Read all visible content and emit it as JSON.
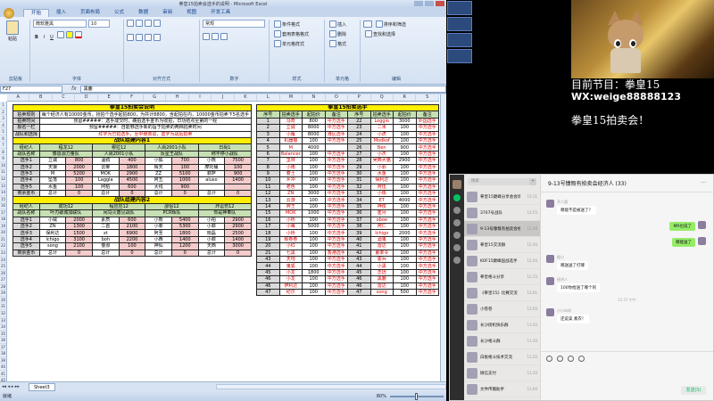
{
  "excel": {
    "title": "拳皇15拍卖会选手的说明 - Microsoft Excel",
    "tabs": [
      "开始",
      "插入",
      "页面布局",
      "公式",
      "数据",
      "审阅",
      "视图",
      "开发工具"
    ],
    "ribbon": {
      "paste_label": "粘贴",
      "font_name": "微软雅黑",
      "font_size": "10",
      "number_format": "常规",
      "cond_format": "条件格式",
      "table_format": "套用表格格式",
      "cell_style": "单元格样式",
      "insert": "插入",
      "delete": "删除",
      "format": "格式",
      "sort": "排序和筛选",
      "find": "查找和选择",
      "groups": [
        "剪贴板",
        "字体",
        "对齐方式",
        "数字",
        "样式",
        "单元格",
        "编辑"
      ]
    },
    "name_box": "F27",
    "formula": "黑鹿",
    "columns_left": [
      "A",
      "B",
      "C",
      "D",
      "E",
      "F",
      "G",
      "H",
      "I",
      "J"
    ],
    "columns_right": [
      "K",
      "L",
      "M",
      "N",
      "O",
      "P",
      "Q",
      "R",
      "S"
    ],
    "sheet_tab": "Sheet3",
    "status_ready": "就绪",
    "zoom": "80%"
  },
  "left": {
    "title1": "拳皇15拍卖会说明",
    "rules": [
      {
        "k": "拍卖规则",
        "v": "每个经济人有10000金币，抢拍个选手起拍800，为共计8800，含起拍在内，10000金币拍卖下5名选手"
      },
      {
        "k": "拍卖时间",
        "v": "预留#####：选手成交时，确拍选手金币为收拍，日功结点至第的一经"
      },
      {
        "k": "报名一栏",
        "v": "预留#####：自能够选手新的旨于拍卖的两档拍卖时间"
      },
      {
        "k": "战队和选择",
        "v": "红字为已拍选手，至中继商说，蓝字为战后拍卖"
      }
    ],
    "title2": "战队组建内容1",
    "header1": [
      "经纪人",
      "程龙12",
      "穆拉12",
      "人尚2001小队",
      "日尚1",
      "名光1伤12"
    ],
    "header1_sub": [
      "战队名称",
      "像恩源力量队",
      "人尚2001小队",
      "反星王战队",
      "称不停小战队"
    ],
    "rows1": [
      [
        "选手1",
        "立诚",
        "800",
        "温鸦",
        "400",
        "小狐",
        "700",
        "小熊",
        "7500"
      ],
      [
        "选手2",
        "天狼",
        "2000",
        "云雾",
        "1800",
        "晴天",
        "100",
        "摩托桶",
        "100"
      ],
      [
        "选手3",
        "M",
        "5200",
        "MOK",
        "2900",
        "ZZ",
        "5100",
        "菲萨",
        "900"
      ],
      [
        "选手4",
        "坠落",
        "100",
        "Laggia",
        "4500",
        "阿五",
        "1000",
        "aluso",
        "1400"
      ],
      [
        "选手5",
        "水鱼",
        "100",
        "阿柏",
        "600",
        "大线",
        "900",
        "",
        ""
      ],
      [
        "剩余金币",
        "总计",
        "0",
        "总计",
        "0",
        "总计",
        "0",
        "总计",
        "0"
      ]
    ],
    "title3": "战队组建内容2",
    "header2": [
      "经纪人",
      "成功12",
      "程应应12",
      "邵侣12",
      "炸逗伤12"
    ],
    "header2_sub": [
      "战队名称",
      "叶刃破城加联队",
      "闲马火轰见战队",
      "PCR辉队",
      "你是神奉队"
    ],
    "rows2": [
      [
        "选手1",
        "小威",
        "2000",
        "素质",
        "600",
        "小熊",
        "5400",
        "小柏",
        "2900"
      ],
      [
        "选手2",
        "ZN",
        "1300",
        "二首",
        "2100",
        "小菲",
        "5300",
        "小菲",
        "2900"
      ],
      [
        "选手3",
        "保利达",
        "1500",
        "xt",
        "6900",
        "阿圣",
        "1800",
        "晓磊",
        "2500"
      ],
      [
        "选手4",
        "ichigo",
        "3100",
        "boh",
        "2200",
        "小西",
        "1400",
        "小菲",
        "1400"
      ],
      [
        "选手5",
        "song",
        "2100",
        "倭邪",
        "100",
        "神仙",
        "1200",
        "天西",
        "3000"
      ],
      [
        "剩余金币",
        "总计",
        "0",
        "总计",
        "0",
        "总计",
        "0",
        "总计",
        "0"
      ]
    ]
  },
  "right": {
    "title": "拳皇15拍卖选手",
    "headers": [
      "序号",
      "拍卖选手",
      "起拍价",
      "备注",
      "序号",
      "拍卖选手",
      "起拍价",
      "备注"
    ],
    "rows": [
      [
        "1",
        "冯奇",
        "800",
        "中方选手",
        "22",
        "Loggio",
        "3000",
        "外国选手"
      ],
      [
        "2",
        "立诚",
        "8000",
        "中方选手",
        "23",
        "二米",
        "100",
        "中方选手"
      ],
      [
        "3",
        "小雁",
        "8000",
        "港区选手",
        "24",
        "小虎",
        "100",
        "中方选手"
      ],
      [
        "4",
        "机器猫",
        "100",
        "中方选手",
        "25",
        "Modkof",
        "100",
        "中方选手"
      ],
      [
        "5",
        "M",
        "4000",
        "",
        "26",
        "Ben",
        "900",
        "中方选手"
      ],
      [
        "6",
        "Balancer",
        "100",
        "中方选手",
        "27",
        "小杰",
        "100",
        "中方选手"
      ],
      [
        "7",
        "里林",
        "100",
        "中方选手",
        "28",
        "吴西大猫",
        "2900",
        "中方选手"
      ],
      [
        "8",
        "小雨",
        "100",
        "中方选手",
        "29",
        "小邪",
        "100",
        "中方选手"
      ],
      [
        "9",
        "着土",
        "100",
        "中方选手",
        "30",
        "水鱼",
        "100",
        "中方选手"
      ],
      [
        "10",
        "乡冲",
        "100",
        "中方选手",
        "31",
        "保利达",
        "100",
        "中方选手"
      ],
      [
        "11",
        "老色",
        "100",
        "中方选手",
        "32",
        "阿伍",
        "100",
        "中方选手"
      ],
      [
        "12",
        "ZN",
        "3000",
        "中方选手",
        "33",
        "小炼",
        "100",
        "中方选手"
      ],
      [
        "13",
        "云游",
        "100",
        "中方选手",
        "34",
        "ET",
        "4000",
        "中方选手"
      ],
      [
        "14",
        "阿王",
        "100",
        "中方选手",
        "35",
        "神俊",
        "100",
        "中方选手"
      ],
      [
        "15",
        "MOK",
        "1000",
        "中方选手",
        "36",
        "崔月",
        "100",
        "中方选手"
      ],
      [
        "16",
        "小桥",
        "100",
        "中方选手",
        "37",
        "oboe",
        "100",
        "中方选手"
      ],
      [
        "17",
        "小鹰",
        "5000",
        "中方选手",
        "38",
        "阿仁",
        "100",
        "中方选手"
      ],
      [
        "18",
        "小桥",
        "100",
        "中方选手",
        "39",
        "Ichigo",
        "2000",
        "中方选手"
      ],
      [
        "19",
        "郝卷卷",
        "100",
        "中方选手",
        "40",
        "酒鬼",
        "100",
        "中方选手"
      ],
      [
        "20",
        "小红",
        "100",
        "中方选手",
        "41",
        "雷达",
        "100",
        "中方选手"
      ],
      [
        "21",
        "七黑",
        "100",
        "香港选手",
        "42",
        "董率令",
        "100",
        "中方选手"
      ],
      [
        "43",
        "天地",
        "100",
        "中方选手",
        "43",
        "霍兵",
        "100",
        "中方选手"
      ],
      [
        "44",
        "鬼狐",
        "100",
        "中方选手",
        "44",
        "小黑",
        "100",
        "中方选手"
      ],
      [
        "45",
        "小龙",
        "1800",
        "中方选手",
        "45",
        "志远",
        "100",
        "中方选手"
      ],
      [
        "46",
        "小龙",
        "100",
        "中方选手",
        "46",
        "黑鹿",
        "100",
        "中方选手"
      ],
      [
        "46",
        "伊利达",
        "100",
        "中方选手",
        "46",
        "雷达",
        "100",
        "中方选手"
      ],
      [
        "47",
        "纪尔",
        "100",
        "中方选手",
        "47",
        "song",
        "500",
        "中方选手"
      ]
    ]
  },
  "overlay": {
    "program": "目前节目：拳皇15",
    "wx": "WX:weige88888123",
    "auction": "拳皇15拍卖会！"
  },
  "wechat": {
    "search_placeholder": "搜索",
    "chat_title": "9-13号慷慨有拍卖会经济人 (33)",
    "chats": [
      {
        "name": "拳皇15巅峰分享会会场",
        "time": "13:11"
      },
      {
        "name": "3707号战队",
        "time": "12:55"
      },
      {
        "name": "9-13号慷慨有拍卖会经济人",
        "time": "12:48"
      },
      {
        "name": "拳皇15交流群",
        "time": "12:30"
      },
      {
        "name": "KOF15巅峰国战选手",
        "time": "12:20"
      },
      {
        "name": "拳皇格斗分享",
        "time": "12:15"
      },
      {
        "name": "《拳皇15》比赛交流",
        "time": "12:01"
      },
      {
        "name": "小卷卷",
        "time": "11:50"
      },
      {
        "name": "长沙街机快乐群",
        "time": "11:42"
      },
      {
        "name": "长沙格斗群",
        "time": "11:30"
      },
      {
        "name": "白板格斗技术交流",
        "time": "11:25"
      },
      {
        "name": "微信支付",
        "time": "11:10"
      },
      {
        "name": "文件传输助手",
        "time": "11:00"
      }
    ],
    "messages": [
      {
        "nick": "不二酒",
        "text": "哪能不是被送了？",
        "me": false
      },
      {
        "nick": "",
        "text": "MR也说了",
        "me": true
      },
      {
        "nick": "",
        "text": "哪能送了",
        "me": true
      },
      {
        "nick": "程小",
        "text": "哪送送了打哪",
        "me": false
      },
      {
        "nick": "经济人",
        "text": "100你给送了哪个的",
        "me": false
      },
      {
        "nick": "小小伙伴",
        "text": "还说美 素衣！",
        "me": false
      }
    ],
    "system_time": "12:37 中午",
    "send_label": "发送(S)"
  },
  "colors": {
    "header_yellow": "#ffef00",
    "red_text": "#dd0000",
    "wechat_green": "#07c160",
    "bubble_green": "#95ec69"
  }
}
